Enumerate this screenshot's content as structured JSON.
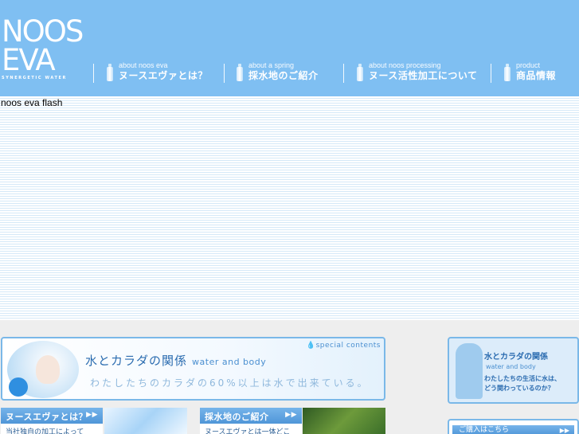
{
  "logo": {
    "line1": "NOOS",
    "line2": "EVA",
    "tagline": "SYNERGETIC WATER"
  },
  "nav": [
    {
      "en": "about noos eva",
      "jp": "ヌースエヴァとは？"
    },
    {
      "en": "about a spring",
      "jp": "採水地のご紹介"
    },
    {
      "en": "about noos processing",
      "jp": "ヌース活性加工について"
    },
    {
      "en": "product",
      "jp": "商品情報"
    }
  ],
  "flash": {
    "label": "noos eva flash"
  },
  "banner": {
    "title_jp": "水とカラダの関係",
    "title_en": "water and body",
    "special": "special contents",
    "subtitle": "わたしたちのカラダの60%以上は水で出来ている。"
  },
  "side_banner": {
    "title": "水とカラダの関係",
    "en": "water and body",
    "line1": "わたしたちの生活に水は、",
    "line2": "どう関わっているのか？"
  },
  "boxes": [
    {
      "head": "ヌースエヴァとは？",
      "arrow": "▶▶",
      "body": "当社独自の加工によって"
    },
    {
      "head": "採水地のご紹介",
      "arrow": "▶▶",
      "body": "ヌースエヴァとは一体どこ"
    }
  ],
  "purchase": {
    "label": "ご購入はこちら",
    "arrow": "▶▶"
  },
  "colors": {
    "header": "#7fbff2",
    "accent": "#4f96d8",
    "page": "#eeeeee"
  }
}
